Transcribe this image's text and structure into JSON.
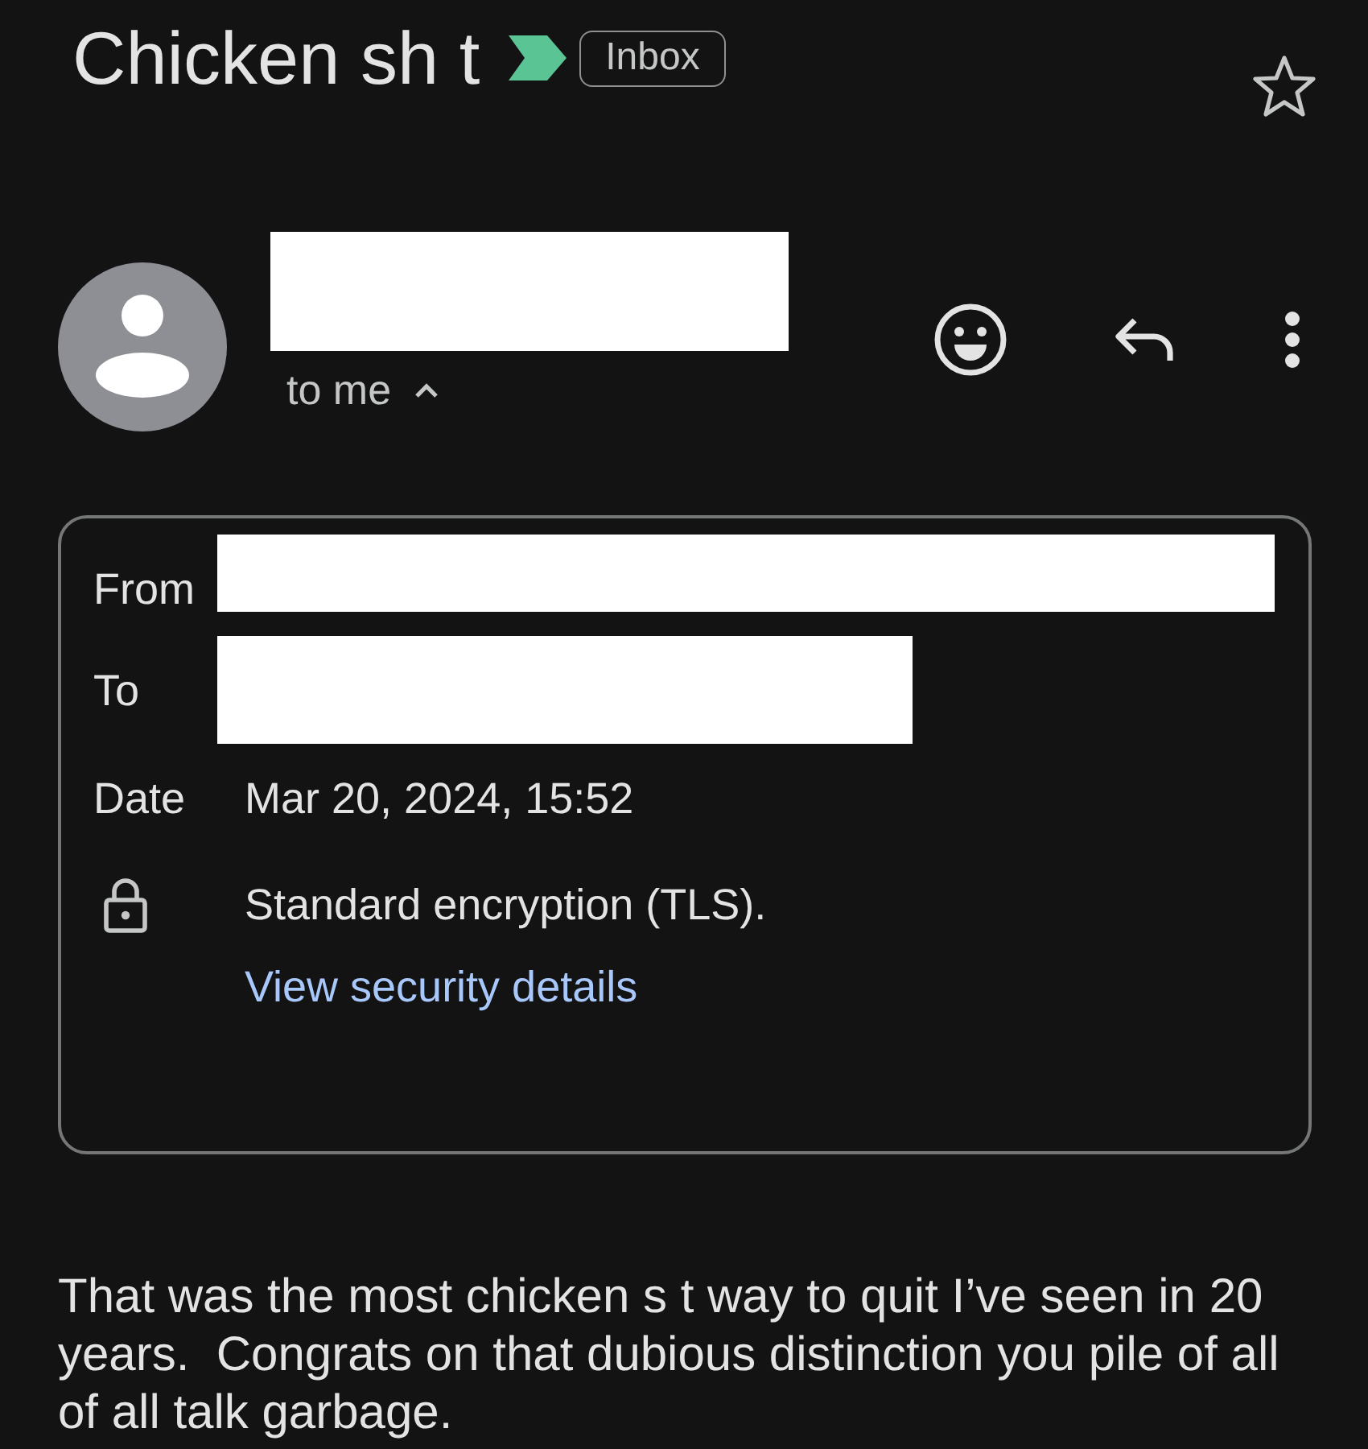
{
  "subject": {
    "title": "Chicken sh t",
    "important": true,
    "label": "Inbox",
    "starred": false
  },
  "sender": {
    "name": {
      "kind": "redacted"
    },
    "recipients": "to me",
    "expanded": true
  },
  "details": {
    "rows": [
      {
        "label": "From",
        "kind": "redacted"
      },
      {
        "label": "To",
        "kind": "redacted"
      },
      {
        "label": "Date",
        "kind": "text",
        "value": "Mar 20, 2024, 15:52"
      }
    ],
    "encryption": "Standard encryption (TLS).",
    "security_link": "View security details"
  },
  "body": "That was the most chicken s t way to quit I’ve seen in 20 years.  Congrats on that dubious distinction you pile of all of all talk garbage."
}
